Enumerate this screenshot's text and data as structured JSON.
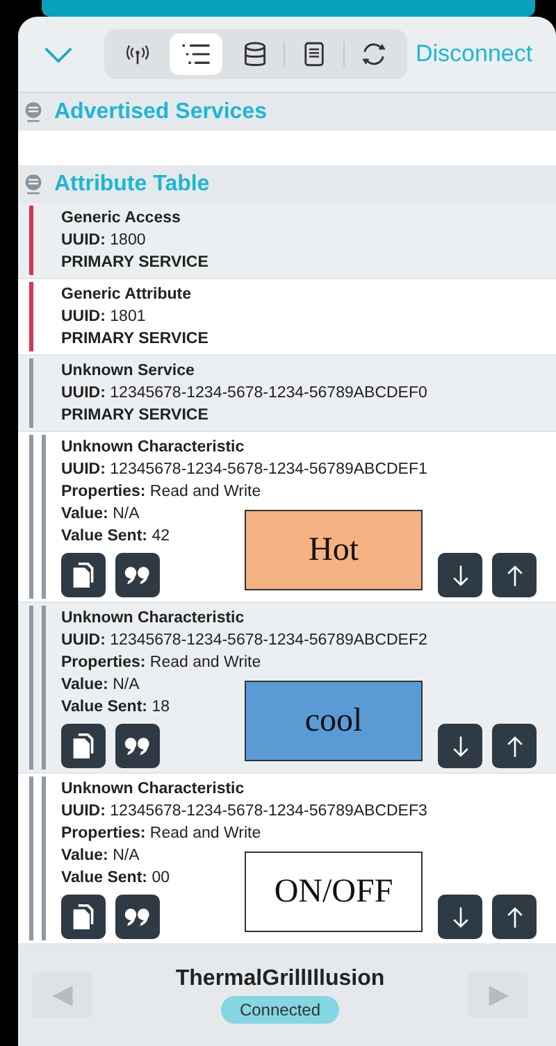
{
  "header": {
    "tabs": [
      {
        "kind": "antenna",
        "selected": false
      },
      {
        "kind": "list",
        "selected": true
      },
      {
        "kind": "database",
        "selected": false
      },
      {
        "kind": "document",
        "selected": false
      },
      {
        "kind": "refresh",
        "selected": false
      }
    ],
    "action": "Disconnect"
  },
  "advertised": {
    "title": "Advertised Services"
  },
  "attribute_table": {
    "title": "Attribute Table",
    "items": [
      {
        "kind": "service",
        "color": "#d9344f",
        "name": "Generic Access",
        "lines": [
          "**UUID:** 1800",
          "PRIMARY SERVICE"
        ]
      },
      {
        "kind": "service",
        "color": "#d9344f",
        "name": "Generic Attribute",
        "lines": [
          "**UUID:** 1801",
          "PRIMARY SERVICE"
        ]
      },
      {
        "kind": "service",
        "color": "#8e9aa4",
        "name": "Unknown Service",
        "lines": [
          "**UUID:** 12345678-1234-5678-1234-56789ABCDEF0",
          "PRIMARY SERVICE"
        ]
      },
      {
        "kind": "characteristic",
        "color": "#8e9aa4",
        "name": "Unknown Characteristic",
        "lines": [
          "**UUID:** 12345678-1234-5678-1234-56789ABCDEF1",
          "**Properties:** Read and Write",
          "**Value:** N/A",
          "**Value Sent:** 42"
        ],
        "label": {
          "text": "Hot",
          "color": "#f4b183"
        }
      },
      {
        "kind": "characteristic",
        "color": "#8e9aa4",
        "name": "Unknown Characteristic",
        "lines": [
          "**UUID:** 12345678-1234-5678-1234-56789ABCDEF2",
          "**Properties:** Read and Write",
          "**Value:** N/A",
          "**Value Sent:** 18"
        ],
        "label": {
          "text": "cool",
          "color": "#5b9bd5"
        }
      },
      {
        "kind": "characteristic",
        "color": "#8e9aa4",
        "name": "Unknown Characteristic",
        "lines": [
          "**UUID:** 12345678-1234-5678-1234-56789ABCDEF3",
          "**Properties:** Read and Write",
          "**Value:** N/A",
          "**Value Sent:** 00"
        ],
        "label": {
          "text": "ON/OFF",
          "color": "#ffffff"
        }
      }
    ]
  },
  "footer": {
    "device": "ThermalGrillIllusion",
    "status": "Connected",
    "prev_disabled": true,
    "next_disabled": true
  }
}
